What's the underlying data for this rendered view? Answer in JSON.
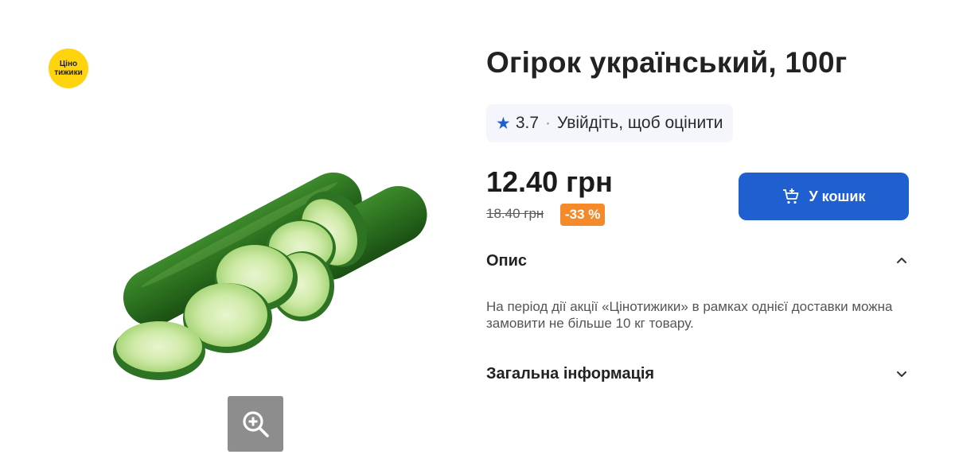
{
  "promo_badge": {
    "line1": "Ціно",
    "line2": "тижики"
  },
  "product": {
    "title": "Огірок український, 100г",
    "image_icon": "cucumber-image",
    "zoom_icon": "zoom-in-icon"
  },
  "rating": {
    "value": "3.7",
    "separator": "·",
    "prompt": "Увійдіть, щоб оцінити",
    "star_color": "#1f5fd0"
  },
  "pricing": {
    "price": "12.40 грн",
    "old_price": "18.40 грн",
    "discount": "-33 %",
    "discount_color": "#f58a2a"
  },
  "cart": {
    "label": "У кошик",
    "icon": "cart-add-icon",
    "color": "#1f5fd0"
  },
  "description": {
    "heading": "Опис",
    "text": "На період дії акції «Цінотижики» в рамках однієї доставки можна замовити не більше 10 кг товару.",
    "expanded": true
  },
  "general_info": {
    "heading": "Загальна інформація",
    "expanded": false
  }
}
